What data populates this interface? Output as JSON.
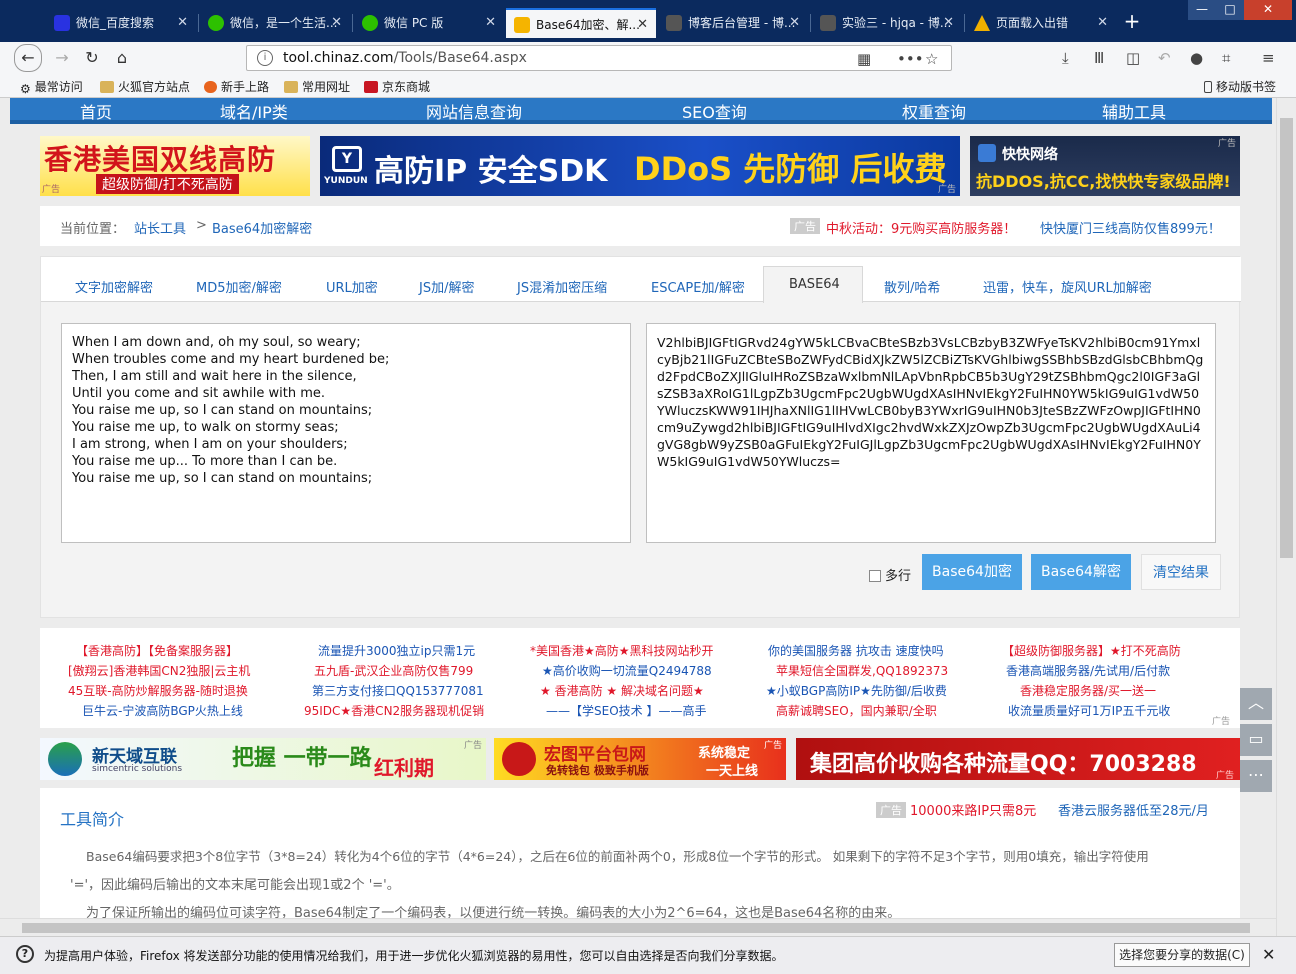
{
  "browser": {
    "tabs": [
      {
        "title": "微信_百度搜索",
        "favicon_color": "#2932e1",
        "active": false
      },
      {
        "title": "微信，是一个生活...",
        "favicon_color": "#2dc100",
        "active": false
      },
      {
        "title": "微信 PC 版",
        "favicon_color": "#2dc100",
        "active": false
      },
      {
        "title": "Base64加密、解...",
        "favicon_color": "#f5b400",
        "active": true
      },
      {
        "title": "博客后台管理 - 博...",
        "favicon_color": "#555555",
        "active": false
      },
      {
        "title": "实验三 - hjqa - 博...",
        "favicon_color": "#555555",
        "active": false
      },
      {
        "title": "页面载入出错",
        "favicon_color": "#f0b000",
        "active": false
      }
    ],
    "new_tab": "+",
    "url_domain": "tool.chinaz.com",
    "url_path": "/Tools/Base64.aspx",
    "window_controls": {
      "minimize": "—",
      "maximize": "□",
      "close": "✕"
    },
    "bookmarks": [
      "最常访问",
      "火狐官方站点",
      "新手上路",
      "常用网址",
      "京东商城"
    ],
    "mobile_bookmarks": "移动版书签"
  },
  "site_nav": [
    "首页",
    "域名/IP类",
    "网站信息查询",
    "SEO查询",
    "权重查询",
    "辅助工具"
  ],
  "banners": {
    "b1_title": "香港美国双线高防",
    "b1_sub": "超级防御/打不死高防",
    "b2_title": "高防IP 安全SDK",
    "b2_sub": "DDoS 先防御 后收费",
    "b2_brand": "YUNDUN",
    "b3_brand": "快快网络",
    "b3_slogan": "抗DDOS,抗CC,找快快专家级品牌!",
    "ad_tag": "广告"
  },
  "breadcrumb": {
    "label": "当前位置：",
    "link1": "站长工具",
    "sep": ">",
    "current": "Base64加密解密",
    "ad_tag": "广告",
    "promo1": "中秋活动：9元购买高防服务器！",
    "promo2": "快快厦门三线高防仅售899元！"
  },
  "tool_tabs": [
    "文字加密解密",
    "MD5加密/解密",
    "URL加密",
    "JS加/解密",
    "JS混淆加密压缩",
    "ESCAPE加/解密",
    "BASE64",
    "散列/哈希",
    "迅雷，快车，旋风URL加解密"
  ],
  "input_text": "When I am down and, oh my soul, so weary;\nWhen troubles come and my heart burdened be;\nThen, I am still and wait here in the silence,\nUntil you come and sit awhile with me.\nYou raise me up, so I can stand on mountains;\nYou raise me up, to walk on stormy seas;\nI am strong, when I am on your shoulders;\nYou raise me up... To more than I can be.\nYou raise me up, so I can stand on mountains;",
  "output_text": "V2hlbiBJIGFtIGRvd24gYW5kLCBvaCBteSBzb3VsLCBzbyB3ZWFyeTsKV2hlbiB0cm91YmxlcyBjb21lIGFuZCBteSBoZWFydCBidXJkZW5lZCBiZTsKVGhlbiwgSSBhbSBzdGlsbCBhbmQgd2FpdCBoZXJlIGluIHRoZSBzaWxlbmNlLApVbnRpbCB5b3UgY29tZSBhbmQgc2l0IGF3aGlsZSB3aXRoIG1lLgpZb3UgcmFpc2UgbWUgdXAsIHNvIEkgY2FuIHN0YW5kIG9uIG1vdW50YWluczsKWW91IHJhaXNlIG1lIHVwLCB0byB3YWxrIG9uIHN0b3JteSBzZWFzOwpJIGFtIHN0cm9uZywgd2hlbiBJIGFtIG9uIHlvdXIgc2hvdWxkZXJzOwpZb3UgcmFpc2UgbWUgdXAuLi4gVG8gbW9yZSB0aGFuIEkgY2FuIGJlLgpZb3UgcmFpc2UgbWUgdXAsIHNvIEkgY2FuIHN0YW5kIG9uIG1vdW50YWluczs=",
  "controls": {
    "multiline": "多行",
    "encode": "Base64加密",
    "decode": "Base64解密",
    "clear": "清空结果"
  },
  "ad_links": [
    [
      "【香港高防】【免备案服务器】",
      "流量提升3000独立ip只需1元",
      "*美国香港★高防★黑科技网站秒开",
      "你的美国服务器 抗攻击 速度快吗",
      "【超级防御服务器】★打不死高防"
    ],
    [
      "[傲翔云]香港韩国CN2独服|云主机",
      "五九盾-武汉企业高防仅售799",
      "★高价收购一切流量Q2494788",
      "苹果短信全国群发,QQ1892373",
      "香港高端服务器/先试用/后付款"
    ],
    [
      "45互联-高防炒解服务器-随时退换",
      "第三方支付接口QQ153777081",
      "★ 香港高防 ★ 解决域名问题★",
      "★小蚁BGP高防IP★先防御/后收费",
      "香港稳定服务器/买一送一"
    ],
    [
      "巨牛云-宁波高防BGP火热上线",
      "95IDC★香港CN2服务器现机促销",
      "——【学SEO技术 】——高手",
      "高薪诚聘SEO，国内兼职/全职",
      "收流量质量好可1万IP五千元收"
    ]
  ],
  "banners2": {
    "c1_brand": "新天域互联",
    "c1_en": "simcentric solutions",
    "c1_slogan": "把握 一带一路",
    "c1_tail": "红利期",
    "c2_title": "宏图平台包网",
    "c2_sub": "免转钱包 极致手机版",
    "c2_r1": "系统稳定",
    "c2_r2": "一天上线",
    "c3_title": "集团高价收购各种流量QQ：7003288"
  },
  "intro": {
    "title": "工具简介",
    "ad_tag": "广告",
    "promo1": "10000来路IP只需8元",
    "promo2": "香港云服务器低至28元/月",
    "p1": "Base64编码要求把3个8位字节（3*8=24）转化为4个6位的字节（4*6=24），之后在6位的前面补两个0，形成8位一个字节的形式。 如果剩下的字符不足3个字节，则用0填充，输出字符使用",
    "p2": "'='，因此编码后输出的文本末尾可能会出现1或2个 '='。",
    "p3": "为了保证所输出的编码位可读字符，Base64制定了一个编码表，以便进行统一转换。编码表的大小为2^6=64，这也是Base64名称的由来。"
  },
  "notice": {
    "text": "为提高用户体验，Firefox 将发送部分功能的使用情况给我们，用于进一步优化火狐浏览器的易用性，您可以自由选择是否向我们分享数据。",
    "button": "选择您要分享的数据(C)",
    "close": "✕"
  },
  "colors": {
    "nav_blue": "#2b78c5",
    "button_blue": "#4ba3e6",
    "link_blue": "#1f66b8",
    "ad_red": "#e0182b"
  }
}
